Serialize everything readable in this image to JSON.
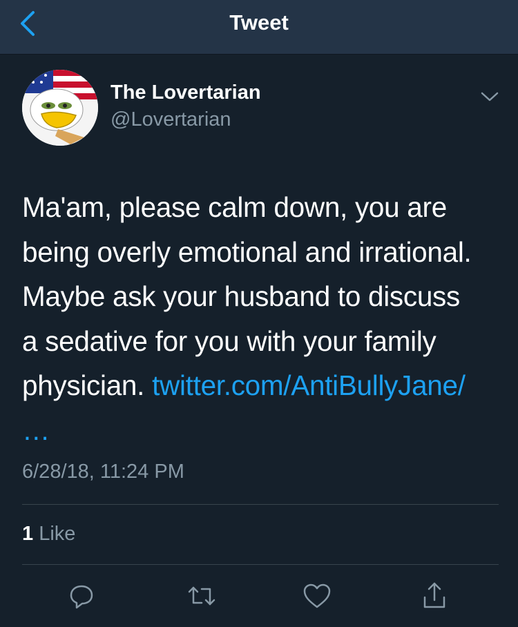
{
  "navbar": {
    "title": "Tweet",
    "back_icon": "chevron-left-icon"
  },
  "tweet": {
    "author": {
      "display_name": "The Lovertarian",
      "handle": "@Lovertarian"
    },
    "text_lines": [
      "Ma'am, please calm down, you are",
      "being overly emotional and irrational.",
      "Maybe ask your husband to discuss",
      "a sedative for you with your family",
      "physician."
    ],
    "link": "twitter.com/AntiBullyJane/",
    "link_ellipsis": "…",
    "timestamp": "6/28/18, 11:24 PM"
  },
  "stats": {
    "likes_count": "1",
    "likes_label": "Like"
  },
  "actions": [
    "reply-icon",
    "retweet-icon",
    "like-icon",
    "share-icon"
  ],
  "colors": {
    "background": "#15202b",
    "navbar": "#243447",
    "accent": "#1da1f2",
    "secondary_text": "#8899a6",
    "divider": "#38444d"
  }
}
